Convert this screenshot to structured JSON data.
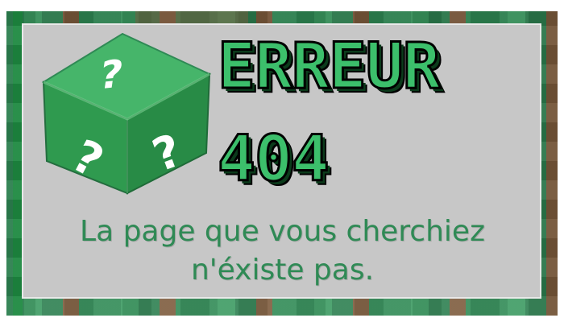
{
  "title": {
    "line1": "ERREUR",
    "line2": "404"
  },
  "message": {
    "line1": "La page que vous cherchiez",
    "line2": "n'éxiste pas."
  },
  "icons": {
    "cube": "question-mark-cube-icon"
  },
  "colors": {
    "accent_green": "#3cbf6b",
    "text_green": "#2f8a55",
    "panel_gray": "#c7c7c7",
    "cube_green": "#2f9a4f"
  }
}
